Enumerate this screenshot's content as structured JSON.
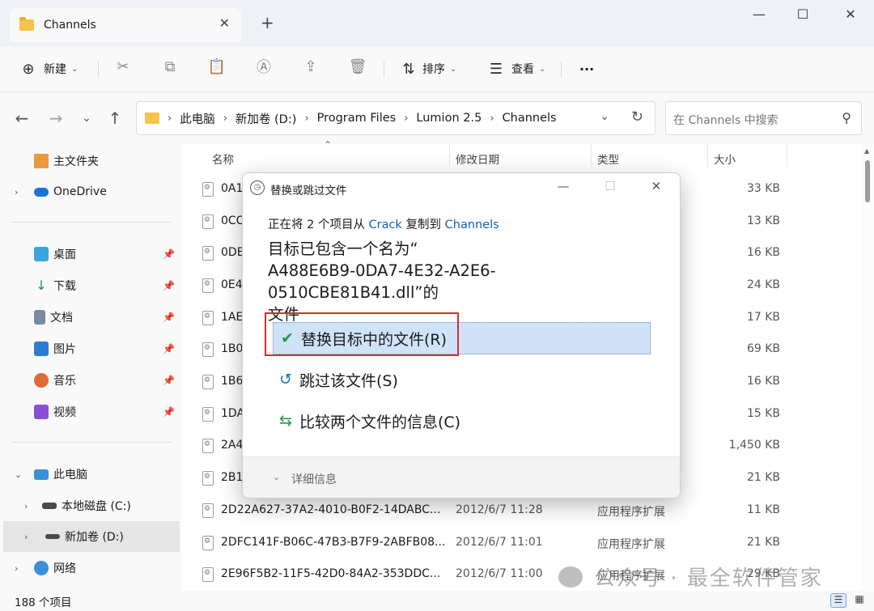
{
  "window": {
    "tab_title": "Channels",
    "tab_close": "✕",
    "new_tab": "+",
    "minimize": "—",
    "maximize": "☐",
    "close": "✕"
  },
  "toolbar": {
    "new_label": "新建",
    "sort_label": "排序",
    "view_label": "查看",
    "more_label": "···"
  },
  "address": {
    "crumbs": [
      "此电脑",
      "新加卷 (D:)",
      "Program Files",
      "Lumion 2.5",
      "Channels"
    ],
    "search_placeholder": "在 Channels 中搜索"
  },
  "sidebar": {
    "home": "主文件夹",
    "onedrive": "OneDrive",
    "quick": [
      "桌面",
      "下载",
      "文档",
      "图片",
      "音乐",
      "视频"
    ],
    "this_pc": "此电脑",
    "drive_c": "本地磁盘 (C:)",
    "drive_d": "新加卷 (D:)",
    "network": "网络"
  },
  "columns": {
    "name": "名称",
    "modified": "修改日期",
    "type": "类型",
    "size": "大小"
  },
  "files": [
    {
      "name": "0A1",
      "date": "",
      "type": "",
      "size": "33 KB"
    },
    {
      "name": "0CC",
      "date": "",
      "type": "",
      "size": "13 KB"
    },
    {
      "name": "0DE",
      "date": "",
      "type": "",
      "size": "16 KB"
    },
    {
      "name": "0E4",
      "date": "",
      "type": "",
      "size": "24 KB"
    },
    {
      "name": "1AE",
      "date": "",
      "type": "",
      "size": "17 KB"
    },
    {
      "name": "1B0",
      "date": "",
      "type": "",
      "size": "69 KB"
    },
    {
      "name": "1B6",
      "date": "",
      "type": "",
      "size": "16 KB"
    },
    {
      "name": "1DA",
      "date": "",
      "type": "",
      "size": "15 KB"
    },
    {
      "name": "2A4",
      "date": "",
      "type": "",
      "size": "1,450 KB"
    },
    {
      "name": "2B1",
      "date": "",
      "type": "",
      "size": "21 KB"
    },
    {
      "name": "2D22A627-37A2-4010-B0F2-14DABC...",
      "date": "2012/6/7 11:28",
      "type": "应用程序扩展",
      "size": "11 KB"
    },
    {
      "name": "2DFC141F-B06C-47B3-B7F9-2ABFB08...",
      "date": "2012/6/7 11:01",
      "type": "应用程序扩展",
      "size": "21 KB"
    },
    {
      "name": "2E96F5B2-11F5-42D0-84A2-353DDC...",
      "date": "2012/6/7 11:00",
      "type": "应用程序扩展",
      "size": "29 KB"
    }
  ],
  "status": {
    "count": "188 个项目"
  },
  "dialog": {
    "title": "替换或跳过文件",
    "sub_prefix": "正在将 2 个项目从 ",
    "sub_from": "Crack",
    "sub_mid": " 复制到 ",
    "sub_to": "Channels",
    "main_line1": "目标已包含一个名为“",
    "main_line2": "A488E6B9-0DA7-4E32-A2E6-0510CBE81B41.dll”的",
    "main_line3": "文件",
    "opt_replace": "替换目标中的文件(R)",
    "opt_skip": "跳过该文件(S)",
    "opt_compare": "比较两个文件的信息(C)",
    "details": "详细信息"
  },
  "watermark": "公众号 · 最全软件管家",
  "colors": {
    "accent": "#0c62c4",
    "highlight_box": "#d72c2c",
    "selected_option": "#cfe3f8"
  }
}
